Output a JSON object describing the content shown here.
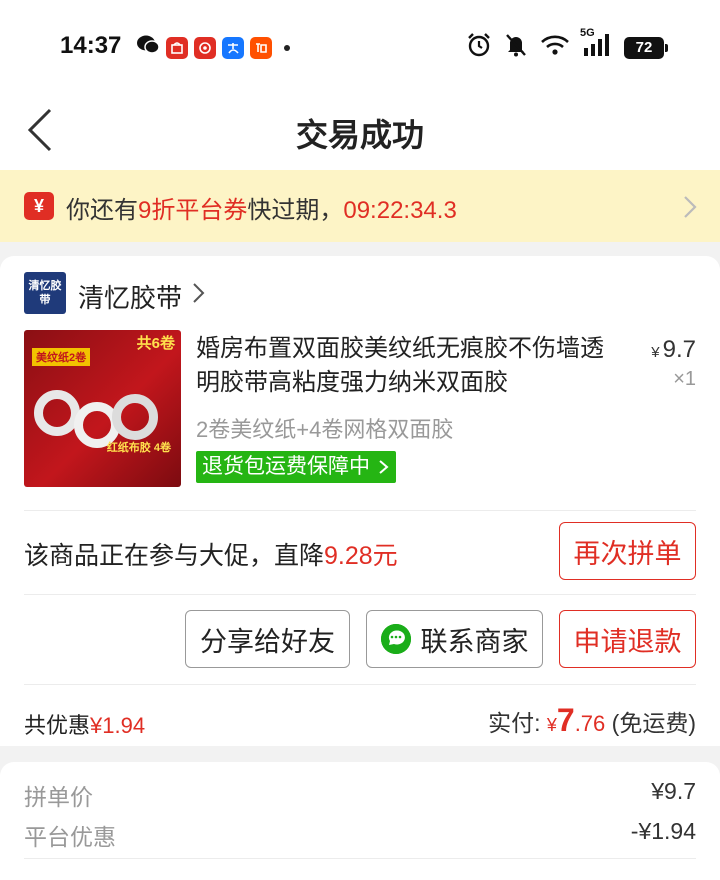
{
  "status_bar": {
    "time": "14:37",
    "battery": "72",
    "network": "5G"
  },
  "nav": {
    "title": "交易成功"
  },
  "coupon": {
    "prefix": "你还有",
    "highlight": "9折平台券",
    "suffix": "快过期，",
    "countdown": "09:22:34.3"
  },
  "shop": {
    "name": "清忆胶带",
    "logo_text": "清忆胶带"
  },
  "product": {
    "title": "婚房布置双面胶美纹纸无痕胶不伤墙透明胶带高粘度强力纳米双面胶",
    "price_symbol": "¥",
    "price": "9.7",
    "quantity": "×1",
    "spec": "2卷美纹纸+4卷网格双面胶",
    "badge": "退货包运费保障中",
    "thumb_tag": "共6卷"
  },
  "promo": {
    "text": "该商品正在参与大促，直降",
    "amount": "9.28元",
    "rebuy_button": "再次拼单"
  },
  "actions": {
    "share": "分享给好友",
    "contact": "联系商家",
    "refund": "申请退款"
  },
  "summary": {
    "saved_label": "共优惠",
    "saved_value": "¥1.94",
    "paid_label": "实付:",
    "paid_currency": "¥",
    "paid_int": "7",
    "paid_dec": ".76",
    "paid_note": "(免运费)"
  },
  "details": [
    {
      "label": "拼单价",
      "value": "¥9.7"
    },
    {
      "label": "平台优惠",
      "value": "-¥1.94"
    }
  ],
  "colors": {
    "accent_red": "#e02e24",
    "green_badge": "#25b513",
    "coupon_bg": "#fdf4c6"
  }
}
